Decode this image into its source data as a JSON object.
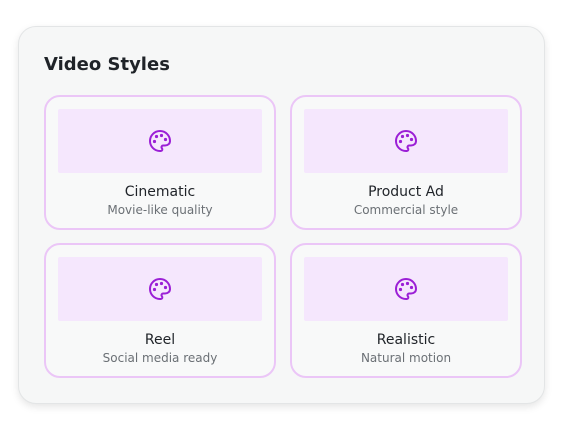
{
  "panel": {
    "title": "Video Styles"
  },
  "styles": [
    {
      "title": "Cinematic",
      "subtitle": "Movie-like quality",
      "icon": "palette-icon"
    },
    {
      "title": "Product Ad",
      "subtitle": "Commercial style",
      "icon": "palette-icon"
    },
    {
      "title": "Reel",
      "subtitle": "Social media ready",
      "icon": "palette-icon"
    },
    {
      "title": "Realistic",
      "subtitle": "Natural motion",
      "icon": "palette-icon"
    }
  ],
  "colors": {
    "accent": "#9b1fd6",
    "card_border": "#ebc6f7",
    "thumb_bg": "#f5e7fd"
  }
}
